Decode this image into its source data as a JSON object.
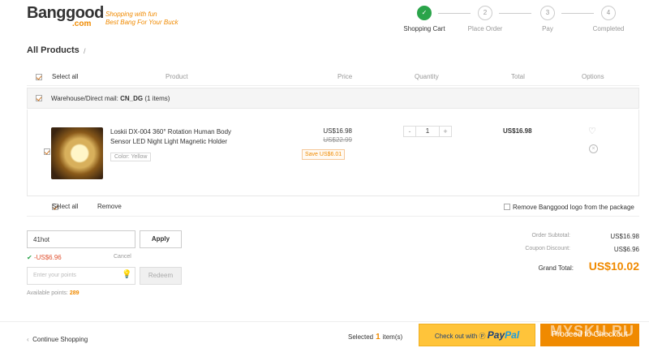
{
  "logo": {
    "brand": "Banggood",
    "domain": ".com",
    "slogan1": "Shopping with fun",
    "slogan2": "Best Bang For Your Buck"
  },
  "steps": [
    {
      "num": "✓",
      "label": "Shopping Cart",
      "done": true
    },
    {
      "num": "2",
      "label": "Place Order",
      "done": false
    },
    {
      "num": "3",
      "label": "Pay",
      "done": false
    },
    {
      "num": "4",
      "label": "Completed",
      "done": false
    }
  ],
  "page": {
    "title": "All Products",
    "title_sep": "/"
  },
  "table_header": {
    "select_all": "Select all",
    "product": "Product",
    "price": "Price",
    "quantity": "Quantity",
    "total": "Total",
    "options": "Options"
  },
  "warehouse": {
    "label": "Warehouse/Direct mail:",
    "code": "CN_DG",
    "count": "(1 items)"
  },
  "product": {
    "name": "Loskii DX-004 360° Rotation Human Body Sensor LED Night Light Magnetic Holder",
    "color": "Color: Yellow",
    "price": "US$16.98",
    "old_price": "US$22.99",
    "save": "Save US$6.01",
    "qty_minus": "-",
    "qty": "1",
    "qty_plus": "+",
    "total": "US$16.98"
  },
  "bottom": {
    "select_all": "Select all",
    "remove": "Remove",
    "remove_logo": "Remove Banggood logo from the package"
  },
  "coupon": {
    "value": "41hot",
    "apply": "Apply",
    "discount": "-US$6.96",
    "cancel": "Cancel"
  },
  "points": {
    "placeholder": "Enter your points",
    "redeem": "Redeem",
    "available_label": "Available points:",
    "available_value": "289"
  },
  "summary": {
    "subtotal_label": "Order Subtotal:",
    "subtotal": "US$16.98",
    "coupon_label": "Coupon Discount:",
    "coupon": "US$6.96",
    "grand_label": "Grand Total:",
    "grand": "US$10.02"
  },
  "footer": {
    "continue": "Continue Shopping",
    "selected_pre": "Selected",
    "selected_count": "1",
    "selected_post": "item(s)",
    "paypal_pre": "Check out with",
    "paypal_a": "Pay",
    "paypal_b": "Pal",
    "checkout": "Proceed to Checkout",
    "watermark": "MYSKU.RU"
  },
  "colors": {
    "accent": "#f08a00",
    "success": "#2aa44a",
    "paypal_yellow": "#ffc43a"
  }
}
